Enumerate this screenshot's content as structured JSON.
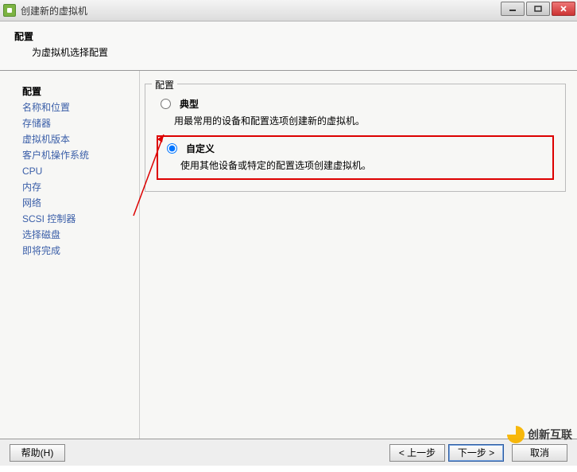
{
  "window": {
    "title": "创建新的虚拟机"
  },
  "header": {
    "title": "配置",
    "subtitle": "为虚拟机选择配置"
  },
  "sidebar": {
    "items": [
      {
        "label": "配置",
        "active": true
      },
      {
        "label": "名称和位置"
      },
      {
        "label": "存储器"
      },
      {
        "label": "虚拟机版本"
      },
      {
        "label": "客户机操作系统"
      },
      {
        "label": "CPU"
      },
      {
        "label": "内存"
      },
      {
        "label": "网络"
      },
      {
        "label": "SCSI 控制器"
      },
      {
        "label": "选择磁盘"
      },
      {
        "label": "即将完成"
      }
    ]
  },
  "groupbox": {
    "legend": "配置",
    "options": [
      {
        "label": "典型",
        "desc": "用最常用的设备和配置选项创建新的虚拟机。",
        "selected": false,
        "highlighted": false
      },
      {
        "label": "自定义",
        "desc": "使用其他设备或特定的配置选项创建虚拟机。",
        "selected": true,
        "highlighted": true
      }
    ]
  },
  "footer": {
    "help": "帮助(H)",
    "back": "< 上一步",
    "next": "下一步 >",
    "cancel": "取消"
  },
  "watermark": {
    "text": "创新互联"
  }
}
